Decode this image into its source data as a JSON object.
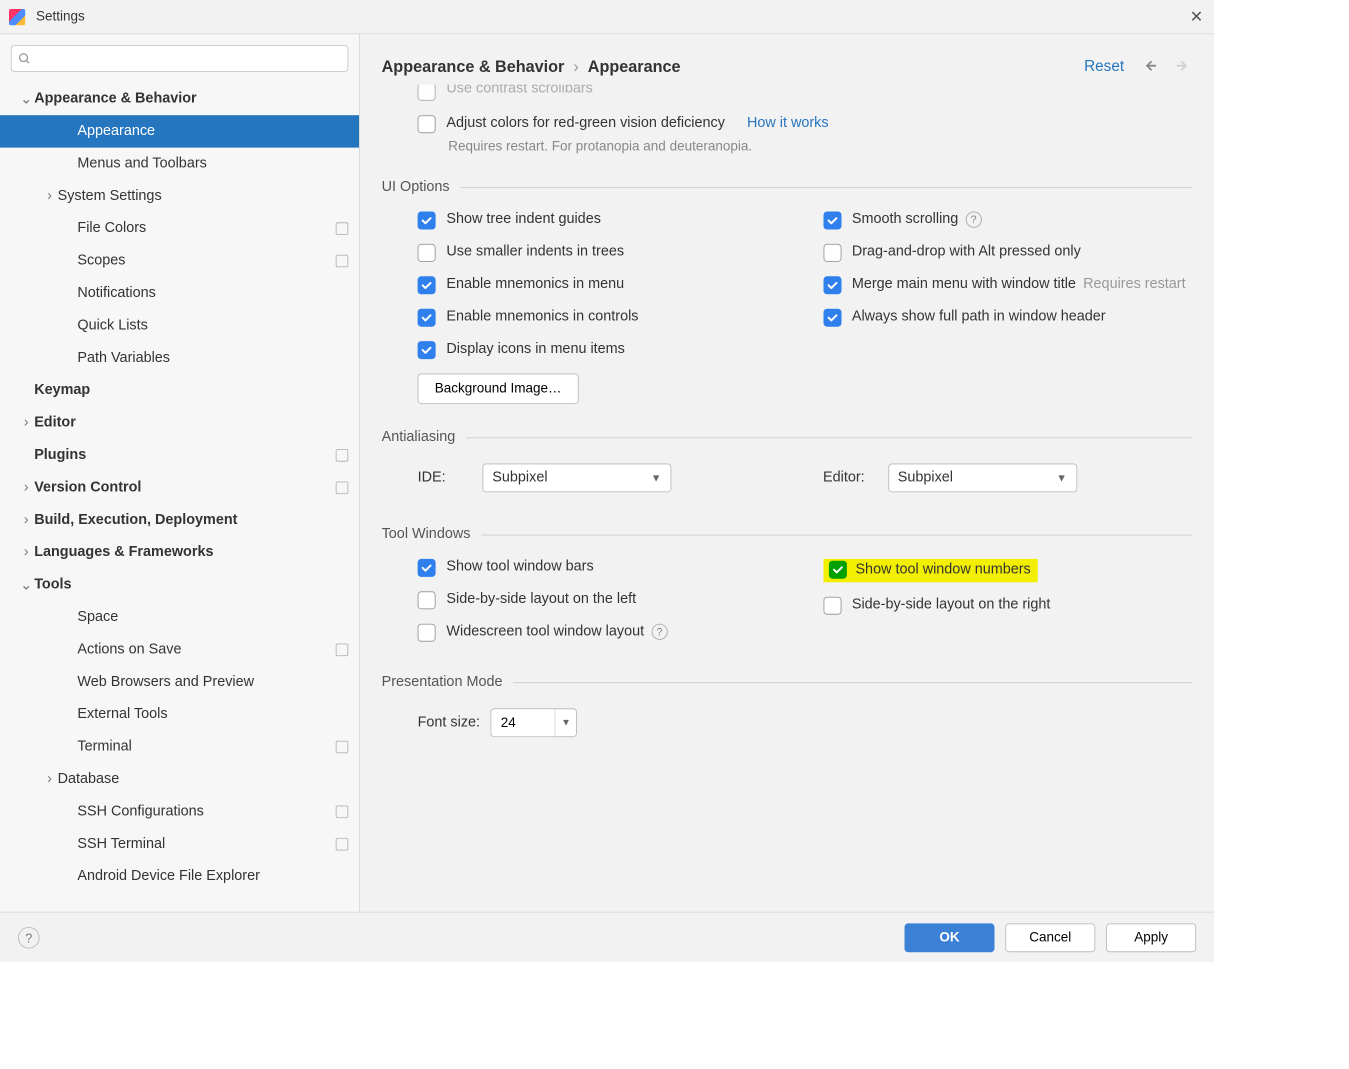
{
  "window": {
    "title": "Settings"
  },
  "search": {
    "placeholder": ""
  },
  "sidebar": {
    "items": [
      {
        "label": "Appearance & Behavior",
        "expanded": true,
        "top": true,
        "children": [
          {
            "label": "Appearance",
            "selected": true
          },
          {
            "label": "Menus and Toolbars"
          },
          {
            "label": "System Settings",
            "hasChildren": true
          },
          {
            "label": "File Colors",
            "badge": true
          },
          {
            "label": "Scopes",
            "badge": true
          },
          {
            "label": "Notifications"
          },
          {
            "label": "Quick Lists"
          },
          {
            "label": "Path Variables"
          }
        ]
      },
      {
        "label": "Keymap",
        "top": true
      },
      {
        "label": "Editor",
        "top": true,
        "hasChildren": true
      },
      {
        "label": "Plugins",
        "top": true,
        "badge": true
      },
      {
        "label": "Version Control",
        "top": true,
        "hasChildren": true,
        "badge": true
      },
      {
        "label": "Build, Execution, Deployment",
        "top": true,
        "hasChildren": true
      },
      {
        "label": "Languages & Frameworks",
        "top": true,
        "hasChildren": true
      },
      {
        "label": "Tools",
        "top": true,
        "expanded": true,
        "children": [
          {
            "label": "Space"
          },
          {
            "label": "Actions on Save",
            "badge": true
          },
          {
            "label": "Web Browsers and Preview"
          },
          {
            "label": "External Tools"
          },
          {
            "label": "Terminal",
            "badge": true
          },
          {
            "label": "Database",
            "hasChildren": true
          },
          {
            "label": "SSH Configurations",
            "badge": true
          },
          {
            "label": "SSH Terminal",
            "badge": true
          },
          {
            "label": "Android Device File Explorer"
          }
        ]
      }
    ]
  },
  "breadcrumb": {
    "root": "Appearance & Behavior",
    "page": "Appearance"
  },
  "header": {
    "reset": "Reset"
  },
  "content": {
    "cutoff": "Use contrast scrollbars",
    "adjust_colors": {
      "label": "Adjust colors for red-green vision deficiency",
      "link": "How it works",
      "desc": "Requires restart. For protanopia and deuteranopia."
    },
    "ui_options": {
      "title": "UI Options",
      "left": [
        {
          "label": "Show tree indent guides",
          "checked": true
        },
        {
          "label": "Use smaller indents in trees",
          "checked": false
        },
        {
          "label": "Enable mnemonics in menu",
          "checked": true
        },
        {
          "label": "Enable mnemonics in controls",
          "checked": true
        },
        {
          "label": "Display icons in menu items",
          "checked": true
        }
      ],
      "right": [
        {
          "label": "Smooth scrolling",
          "checked": true,
          "help": true
        },
        {
          "label": "Drag-and-drop with Alt pressed only",
          "checked": false
        },
        {
          "label": "Merge main menu with window title",
          "checked": true,
          "hint": "Requires restart"
        },
        {
          "label": "Always show full path in window header",
          "checked": true
        }
      ],
      "bg_button": "Background Image…"
    },
    "antialiasing": {
      "title": "Antialiasing",
      "ide_label": "IDE:",
      "ide_value": "Subpixel",
      "editor_label": "Editor:",
      "editor_value": "Subpixel"
    },
    "tool_windows": {
      "title": "Tool Windows",
      "left": [
        {
          "label": "Show tool window bars",
          "checked": true
        },
        {
          "label": "Side-by-side layout on the left",
          "checked": false
        },
        {
          "label": "Widescreen tool window layout",
          "checked": false,
          "help": true
        }
      ],
      "right": [
        {
          "label": "Show tool window numbers",
          "checked": true,
          "highlight": true,
          "green": true
        },
        {
          "label": "Side-by-side layout on the right",
          "checked": false
        }
      ]
    },
    "presentation": {
      "title": "Presentation Mode",
      "font_label": "Font size:",
      "font_value": "24"
    }
  },
  "footer": {
    "ok": "OK",
    "cancel": "Cancel",
    "apply": "Apply"
  }
}
